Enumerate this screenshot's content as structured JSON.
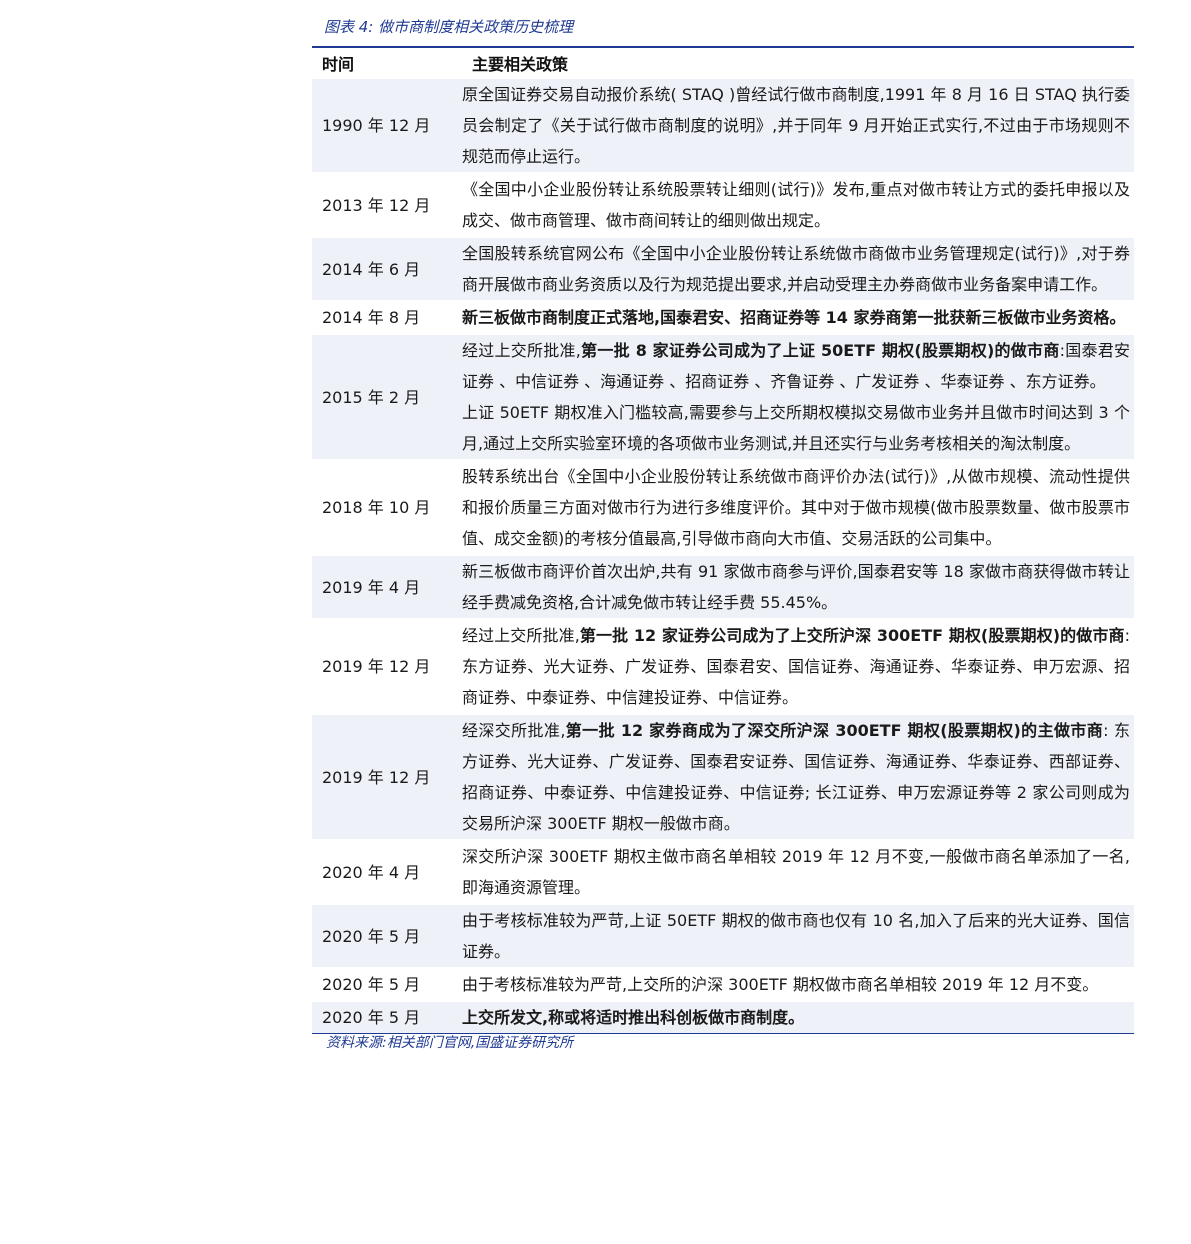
{
  "caption": "图表 4: 做市商制度相关政策历史梳理",
  "headers": {
    "time": "时间",
    "policy": "主要相关政策"
  },
  "rows": [
    {
      "time": "1990 年 12 月",
      "policy": [
        {
          "t": "原全国证券交易自动报价系统( STAQ )曾经试行做市商制度,1991 年 8 月 16 日 STAQ 执行委员会制定了《关于试行做市商制度的说明》,并于同年 9 月开始正式实行,不过由于市场规则不规范而停止运行。"
        }
      ]
    },
    {
      "time": "2013 年 12 月",
      "policy": [
        {
          "t": "《全国中小企业股份转让系统股票转让细则(试行)》发布,重点对做市转让方式的委托申报以及成交、做市商管理、做市商间转让的细则做出规定。"
        }
      ]
    },
    {
      "time": "2014 年 6 月",
      "policy": [
        {
          "t": "全国股转系统官网公布《全国中小企业股份转让系统做市商做市业务管理规定(试行)》,对于券商开展做市商业务资质以及行为规范提出要求,并启动受理主办券商做市业务备案申请工作。"
        }
      ]
    },
    {
      "time": "2014 年 8 月",
      "policy": [
        {
          "t": "新三板做市商制度正式落地,国泰君安、招商证券等 14 家券商第一批获新三板做市业务资格。",
          "b": true
        }
      ]
    },
    {
      "time": "2015 年 2 月",
      "policy": [
        {
          "t": "经过上交所批准,"
        },
        {
          "t": "第一批 8 家证券公司成为了上证 50ETF 期权(股票期权)的做市商",
          "b": true
        },
        {
          "t": ":国泰君安证券 、中信证券 、海通证券 、招商证券 、齐鲁证券 、广发证券 、华泰证券 、东方证券。"
        },
        {
          "br": true
        },
        {
          "t": "上证 50ETF 期权准入门槛较高,需要参与上交所期权模拟交易做市业务并且做市时间达到 3 个月,通过上交所实验室环境的各项做市业务测试,并且还实行与业务考核相关的淘汰制度。"
        }
      ]
    },
    {
      "time": "2018 年 10 月",
      "policy": [
        {
          "t": "股转系统出台《全国中小企业股份转让系统做市商评价办法(试行)》,从做市规模、流动性提供和报价质量三方面对做市行为进行多维度评价。其中对于做市规模(做市股票数量、做市股票市值、成交金额)的考核分值最高,引导做市商向大市值、交易活跃的公司集中。"
        }
      ]
    },
    {
      "time": "2019 年 4 月",
      "policy": [
        {
          "t": "新三板做市商评价首次出炉,共有 91 家做市商参与评价,国泰君安等 18 家做市商获得做市转让经手费减免资格,合计减免做市转让经手费 55.45%。"
        }
      ]
    },
    {
      "time": "2019 年 12 月",
      "policy": [
        {
          "t": "经过上交所批准,"
        },
        {
          "t": "第一批 12 家证券公司成为了上交所沪深 300ETF 期权(股票期权)的做市商",
          "b": true
        },
        {
          "t": ":东方证券、光大证券、广发证券、国泰君安、国信证券、海通证券、华泰证券、申万宏源、招商证券、中泰证券、中信建投证券、中信证券。"
        }
      ]
    },
    {
      "time": "2019 年 12 月",
      "policy": [
        {
          "t": "经深交所批准,"
        },
        {
          "t": "第一批 12 家券商成为了深交所沪深 300ETF 期权(股票期权)的主做市商",
          "b": true
        },
        {
          "t": ": 东方证券、光大证券、广发证券、国泰君安证券、国信证券、海通证券、华泰证券、西部证券、招商证券、中泰证券、中信建投证券、中信证券; 长江证券、申万宏源证券等 2 家公司则成为交易所沪深 300ETF 期权一般做市商。"
        }
      ]
    },
    {
      "time": "2020 年 4 月",
      "policy": [
        {
          "t": "深交所沪深 300ETF 期权主做市商名单相较 2019 年 12 月不变,一般做市商名单添加了一名,即海通资源管理。"
        }
      ]
    },
    {
      "time": "2020 年 5 月",
      "policy": [
        {
          "t": "由于考核标准较为严苛,上证 50ETF 期权的做市商也仅有 10 名,加入了后来的光大证券、国信证券。"
        }
      ]
    },
    {
      "time": "2020 年 5 月",
      "policy": [
        {
          "t": "由于考核标准较为严苛,上交所的沪深 300ETF 期权做市商名单相较 2019 年 12 月不变。"
        }
      ]
    },
    {
      "time": "2020 年 5 月",
      "policy": [
        {
          "t": "上交所发文,称或将适时推出科创板做市商制度。",
          "b": true
        }
      ]
    }
  ],
  "source": "资料来源:相关部门官网,国盛证券研究所",
  "colors": {
    "accent": "#1f3a93",
    "band": "#eef1f7"
  }
}
